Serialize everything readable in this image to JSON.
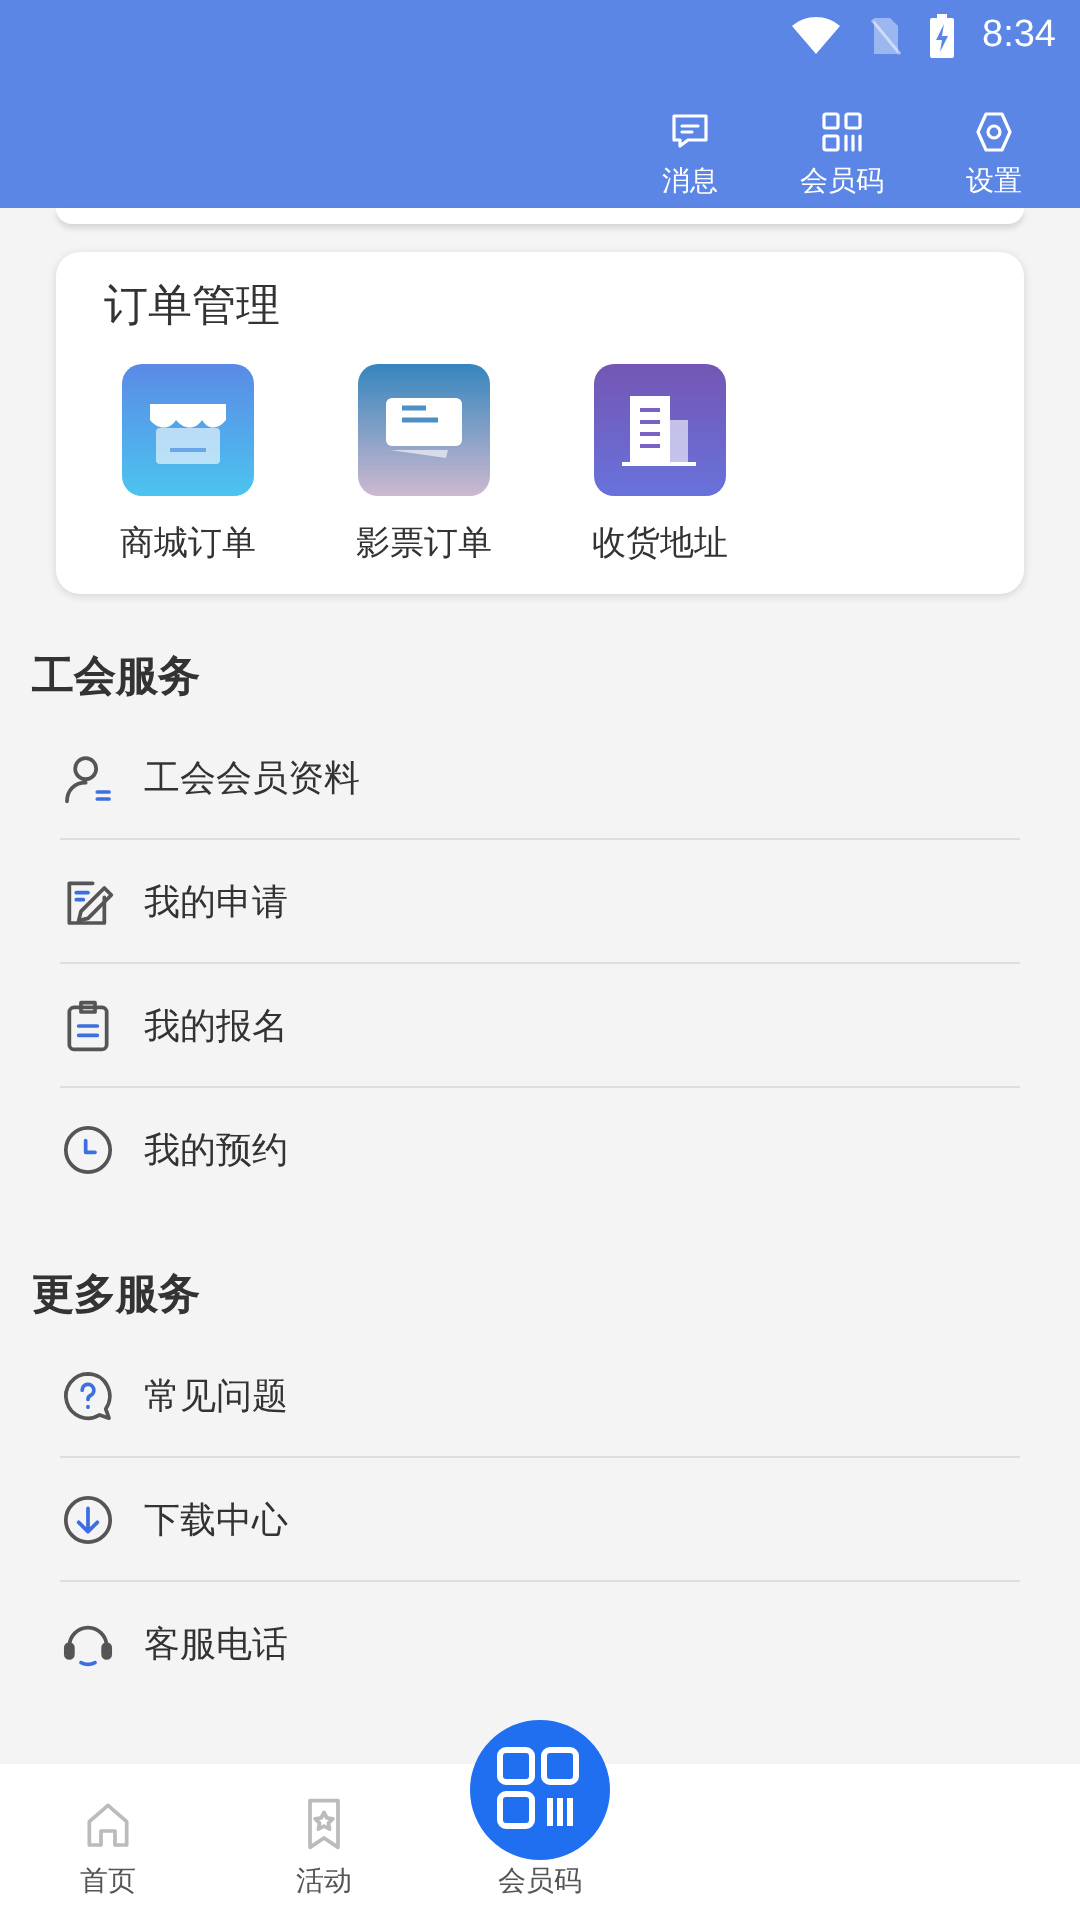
{
  "status_bar": {
    "time": "8:34"
  },
  "header": {
    "actions": [
      {
        "kind": "message",
        "label": "消息"
      },
      {
        "kind": "qr",
        "label": "会员码"
      },
      {
        "kind": "settings",
        "label": "设置"
      }
    ]
  },
  "order_card": {
    "title": "订单管理",
    "items": [
      {
        "kind": "shop",
        "label": "商城订单"
      },
      {
        "kind": "ticket",
        "label": "影票订单"
      },
      {
        "kind": "building",
        "label": "收货地址"
      }
    ]
  },
  "sections": [
    {
      "title": "工会服务",
      "items": [
        {
          "kind": "person",
          "label": "工会会员资料"
        },
        {
          "kind": "edit",
          "label": "我的申请"
        },
        {
          "kind": "clipboard",
          "label": "我的报名"
        },
        {
          "kind": "clock",
          "label": "我的预约"
        }
      ]
    },
    {
      "title": "更多服务",
      "items": [
        {
          "kind": "question",
          "label": "常见问题"
        },
        {
          "kind": "download",
          "label": "下载中心"
        },
        {
          "kind": "headset",
          "label": "客服电话"
        }
      ]
    }
  ],
  "bottom_nav": {
    "items": [
      {
        "kind": "home",
        "label": "首页"
      },
      {
        "kind": "activity",
        "label": "活动"
      },
      {
        "kind": "qr_center",
        "label": "会员码"
      }
    ]
  }
}
